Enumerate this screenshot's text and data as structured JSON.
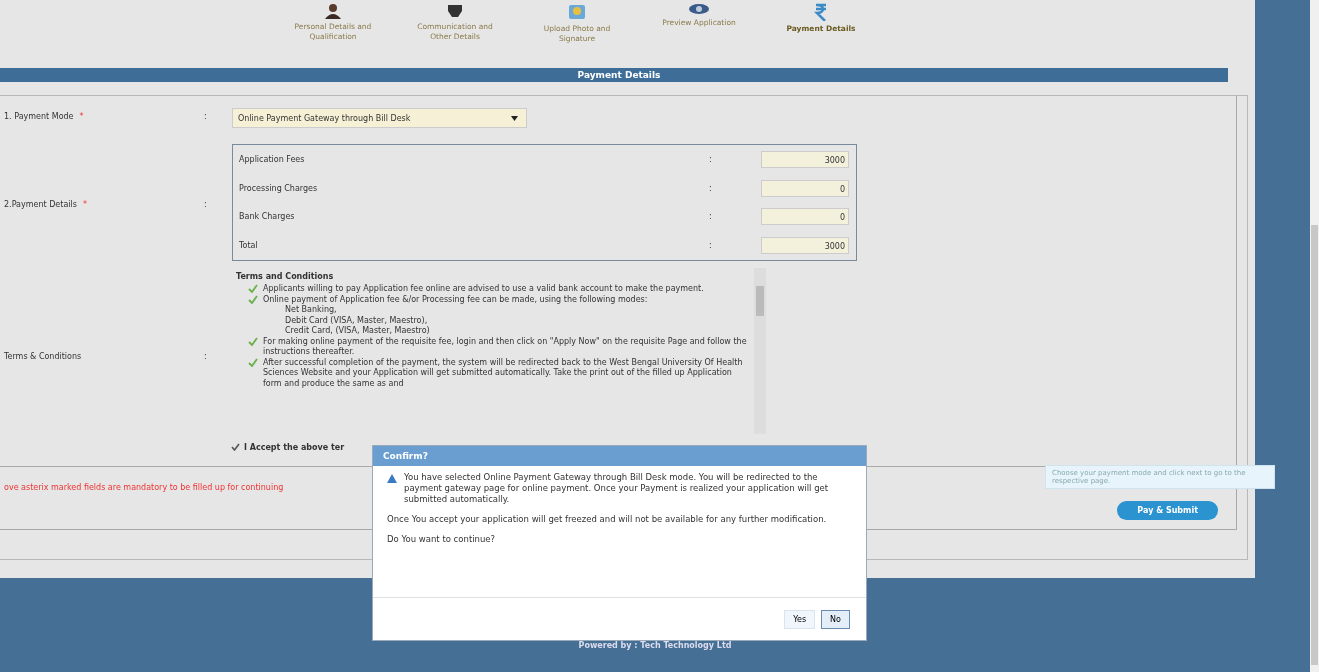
{
  "steps": [
    {
      "kind": "person",
      "label": "Personal Details and Qualification",
      "selected": false
    },
    {
      "kind": "contact",
      "label": "Communication and Other Details",
      "selected": false
    },
    {
      "kind": "photo",
      "label": "Upload Photo and Signature",
      "selected": false
    },
    {
      "kind": "eye",
      "label": "Preview Application",
      "selected": false
    },
    {
      "kind": "rupee",
      "label": "Payment Details",
      "selected": true
    }
  ],
  "section_title": "Payment Details",
  "payment_mode": {
    "label": "1. Payment Mode",
    "required_mark": "*",
    "colon": ":",
    "value": "Online Payment Gateway through Bill Desk"
  },
  "payment_details": {
    "label": "2.Payment Details",
    "required_mark": "*",
    "colon": ":",
    "rows": [
      {
        "label": "Application Fees",
        "colon": ":",
        "value": "3000"
      },
      {
        "label": "Processing Charges",
        "colon": ":",
        "value": "0"
      },
      {
        "label": "Bank Charges",
        "colon": ":",
        "value": "0"
      },
      {
        "label": "Total",
        "colon": ":",
        "value": "3000"
      }
    ]
  },
  "terms": {
    "label": "Terms & Conditions",
    "colon": ":",
    "title": "Terms and Conditions",
    "items": [
      {
        "text": "Applicants willing to pay Application fee online are advised to use a valid bank account to make the payment."
      },
      {
        "text": "Online payment of Application fee &/or Processing fee can be made, using the following modes:",
        "sub": [
          "Net Banking,",
          "Debit Card (VISA, Master, Maestro),",
          "Credit Card, (VISA, Master, Maestro)"
        ]
      },
      {
        "text": "For making online payment of the requisite fee, login and then click on \"Apply Now\" on the requisite Page and follow the instructions thereafter."
      },
      {
        "text": "After successful completion of the payment, the system will be redirected back to the West Bengal University Of Health Sciences Website and your Application will get submitted automatically. Take the print out of the filled up Application form and produce the same as and"
      }
    ],
    "accept": {
      "label": "I Accept the above ter",
      "checked": true
    }
  },
  "mandatory_note": "ove asterix marked fields are mandatory to be filled up for continuing",
  "tooltip": "Choose your payment mode and click next to go to the respective page.",
  "submit_button": "Pay & Submit",
  "footer": "Powered by : Tech Technology Ltd",
  "dialog": {
    "title": "Confirm?",
    "message": "You have selected Online Payment Gateway through Bill Desk mode. You will be redirected to the payment gateway page for online payment. Once your Payment is realized your application will get submitted automatically.",
    "note": "Once You accept your application will get freezed and will not be available for any further modification.",
    "question": "Do You want to continue?",
    "buttons": [
      {
        "label": "Yes",
        "selected": false
      },
      {
        "label": "No",
        "selected": true
      }
    ]
  }
}
